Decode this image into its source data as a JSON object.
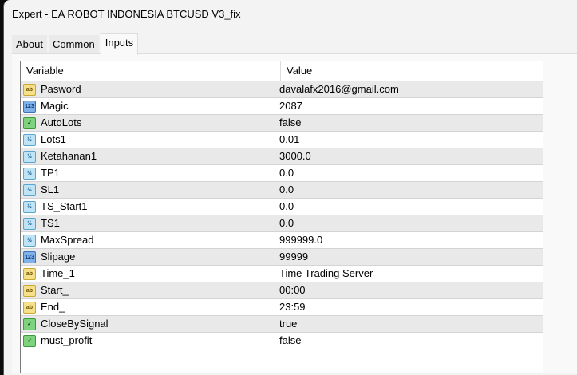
{
  "window": {
    "title": "Expert - EA ROBOT INDONESIA  BTCUSD V3_fix"
  },
  "tabs": [
    "About",
    "Common",
    "Inputs"
  ],
  "columns": {
    "variable": "Variable",
    "value": "Value"
  },
  "rows": [
    {
      "type": "ab",
      "name": "Pasword",
      "value": "davalafx2016@gmail.com"
    },
    {
      "type": "123",
      "name": "Magic",
      "value": "2087"
    },
    {
      "type": "bool",
      "name": "AutoLots",
      "value": "false"
    },
    {
      "type": "dbl",
      "name": "Lots1",
      "value": "0.01"
    },
    {
      "type": "dbl",
      "name": "Ketahanan1",
      "value": "3000.0"
    },
    {
      "type": "dbl",
      "name": "TP1",
      "value": "0.0"
    },
    {
      "type": "dbl",
      "name": "SL1",
      "value": "0.0"
    },
    {
      "type": "dbl",
      "name": "TS_Start1",
      "value": "0.0"
    },
    {
      "type": "dbl",
      "name": "TS1",
      "value": "0.0"
    },
    {
      "type": "dbl",
      "name": "MaxSpread",
      "value": "999999.0"
    },
    {
      "type": "123",
      "name": "Slipage",
      "value": "99999"
    },
    {
      "type": "ab",
      "name": "Time_1",
      "value": "Time  Trading Server"
    },
    {
      "type": "ab",
      "name": "Start_",
      "value": "00:00"
    },
    {
      "type": "ab",
      "name": "End_",
      "value": "23:59"
    },
    {
      "type": "bool",
      "name": "CloseBySignal",
      "value": "true"
    },
    {
      "type": "bool",
      "name": "must_profit",
      "value": "false"
    }
  ]
}
